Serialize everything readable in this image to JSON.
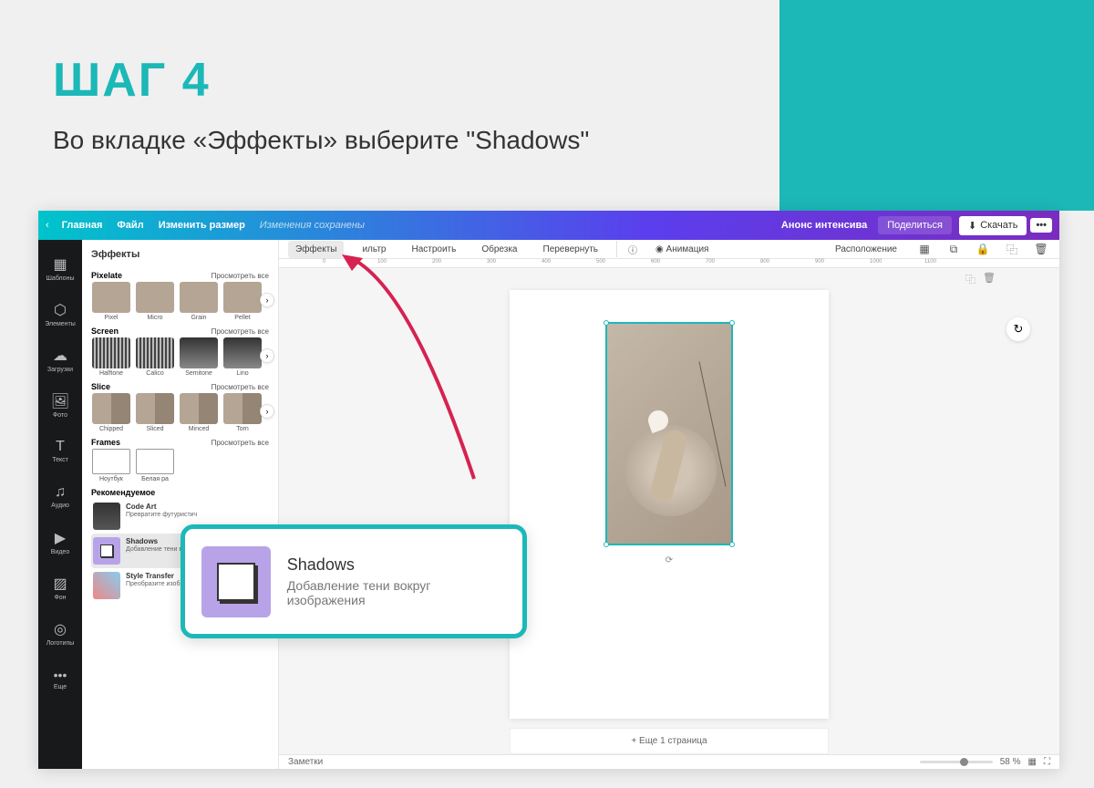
{
  "step": {
    "title": "ШАГ 4",
    "subtitle": "Во вкладке «Эффекты» выберите \"Shadows\""
  },
  "topbar": {
    "home": "Главная",
    "file": "Файл",
    "resize": "Изменить размер",
    "status": "Изменения сохранены",
    "announce": "Анонс интенсива",
    "share": "Поделиться",
    "download": "Скачать",
    "more": "•••"
  },
  "navitems": [
    {
      "icon": "▦",
      "label": "Шаблоны"
    },
    {
      "icon": "⬡",
      "label": "Элементы"
    },
    {
      "icon": "☁",
      "label": "Загрузки"
    },
    {
      "icon": "🖼",
      "label": "Фото"
    },
    {
      "icon": "T",
      "label": "Текст"
    },
    {
      "icon": "♫",
      "label": "Аудио"
    },
    {
      "icon": "▶",
      "label": "Видео"
    },
    {
      "icon": "▨",
      "label": "Фон"
    },
    {
      "icon": "◎",
      "label": "Логотипы"
    },
    {
      "icon": "•••",
      "label": "Еще"
    }
  ],
  "panel": {
    "title": "Эффекты",
    "view_all": "Просмотреть все",
    "sections": {
      "pixelate": {
        "name": "Pixelate",
        "items": [
          "Pixel",
          "Micro",
          "Grain",
          "Pellet"
        ]
      },
      "screen": {
        "name": "Screen",
        "items": [
          "Halftone",
          "Calico",
          "Semitone",
          "Lino"
        ]
      },
      "slice": {
        "name": "Slice",
        "items": [
          "Chipped",
          "Sliced",
          "Minced",
          "Torn"
        ]
      },
      "frames": {
        "name": "Frames",
        "items": [
          "Ноутбук",
          "Белая ра"
        ]
      }
    },
    "recommended": {
      "title": "Рекомендуемое",
      "items": [
        {
          "name": "Code Art",
          "desc": "Превратите\nфутуристич"
        },
        {
          "name": "Shadows",
          "desc": "Добавление тени вокруг\nизображения"
        },
        {
          "name": "Style Transfer",
          "desc": "Преобразите изображение одним\nнажатием"
        }
      ]
    }
  },
  "toolbar": {
    "effects": "Эффекты",
    "filter": "ильтр",
    "adjust": "Настроить",
    "crop": "Обрезка",
    "flip": "Перевернуть",
    "animate": "Анимация",
    "position": "Расположение"
  },
  "ruler": [
    "0",
    "100",
    "200",
    "300",
    "400",
    "500",
    "600",
    "700",
    "800",
    "900",
    "1000",
    "1100"
  ],
  "canvas": {
    "add_page": "+ Еще 1 страница"
  },
  "bottombar": {
    "notes": "Заметки",
    "zoom": "58 %"
  },
  "callout": {
    "title": "Shadows",
    "desc": "Добавление тени вокруг изображения"
  }
}
